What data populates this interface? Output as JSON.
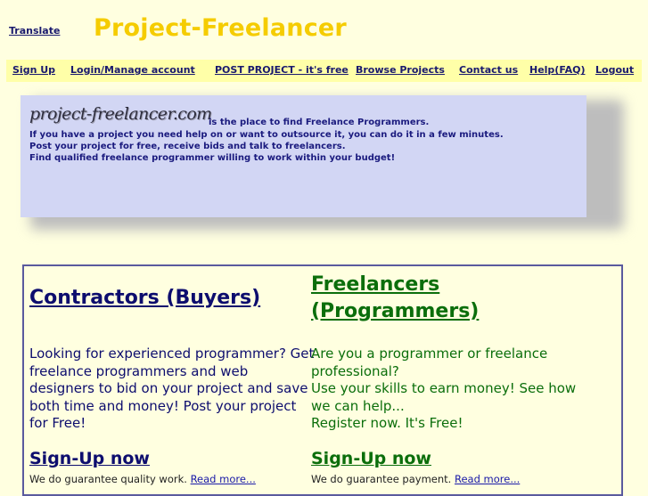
{
  "header": {
    "translate_label": "Translate",
    "site_title": "Project-Freelancer"
  },
  "nav": {
    "items": [
      {
        "label": "Sign Up"
      },
      {
        "label": "Login/Manage account"
      },
      {
        "label": "POST PROJECT - it's free"
      },
      {
        "label": "Browse Projects"
      },
      {
        "label": "Contact us"
      },
      {
        "label": "Help(FAQ)"
      },
      {
        "label": "Logout"
      }
    ]
  },
  "intro": {
    "logo_text": "project-freelancer.com",
    "tagline": "is the place to find Freelance Programmers.",
    "lines": [
      "If you have a project you need help on or want to outsource it, you can do it in a few minutes.",
      "Post your project for free, receive bids and talk to freelancers.",
      "Find qualified freelance programmer willing to work within your budget!"
    ]
  },
  "contractors": {
    "heading": "Contractors (Buyers)",
    "body": "Looking for experienced programmer? Get freelance programmers and web designers to bid on your project and save both time and money! Post your project for Free!",
    "signup_label": "Sign-Up now",
    "guarantee_text": "We do guarantee quality work.",
    "read_more_label": "Read more..."
  },
  "freelancers": {
    "heading": "Freelancers (Programmers)",
    "body_lines": [
      "Are you a programmer or freelance professional?",
      "Use your skills to earn money! See how we can help...",
      "Register now. It's Free!"
    ],
    "signup_label": "Sign-Up now",
    "guarantee_text": "We do guarantee payment.",
    "read_more_label": "Read more..."
  },
  "colors": {
    "page_background": "#ffffe0",
    "nav_background": "#ffffa8",
    "title_color": "#f5cc00",
    "panel_background": "#d2d6f4",
    "buyer_color": "#0d0d6e",
    "freelancer_color": "#0b6e0b",
    "border_color": "#5a5a9e"
  }
}
